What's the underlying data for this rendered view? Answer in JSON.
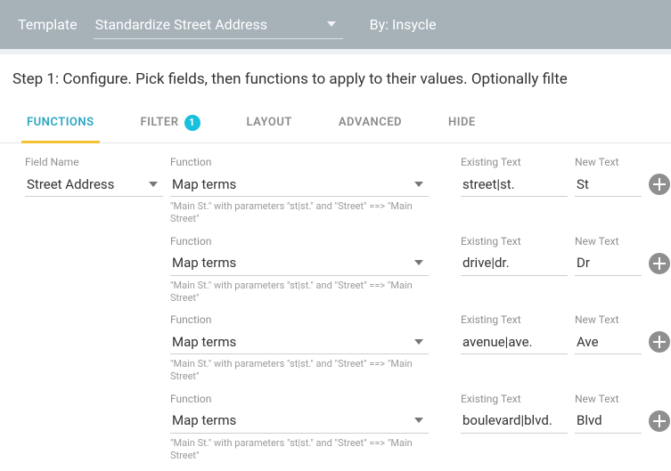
{
  "header": {
    "template_label": "Template",
    "template_value": "Standardize Street Address",
    "by_label": "By: Insycle"
  },
  "step": {
    "text": "Step 1: Configure. Pick fields, then functions to apply to their values. Optionally filte"
  },
  "tabs": {
    "functions": "FUNCTIONS",
    "filter": "FILTER",
    "filter_count": "1",
    "layout": "LAYOUT",
    "advanced": "ADVANCED",
    "hide": "HIDE"
  },
  "labels": {
    "field_name": "Field Name",
    "function": "Function",
    "existing_text": "Existing Text",
    "new_text": "New Text"
  },
  "hint": "\"Main St.\" with parameters \"st|st.\" and \"Street\" ==> \"Main Street\"",
  "rows": [
    {
      "field": "Street Address",
      "function": "Map terms",
      "existing": "street|st.",
      "new": "St"
    },
    {
      "field": "",
      "function": "Map terms",
      "existing": "drive|dr.",
      "new": "Dr"
    },
    {
      "field": "",
      "function": "Map terms",
      "existing": "avenue|ave.",
      "new": "Ave"
    },
    {
      "field": "",
      "function": "Map terms",
      "existing": "boulevard|blvd.",
      "new": "Blvd"
    }
  ]
}
